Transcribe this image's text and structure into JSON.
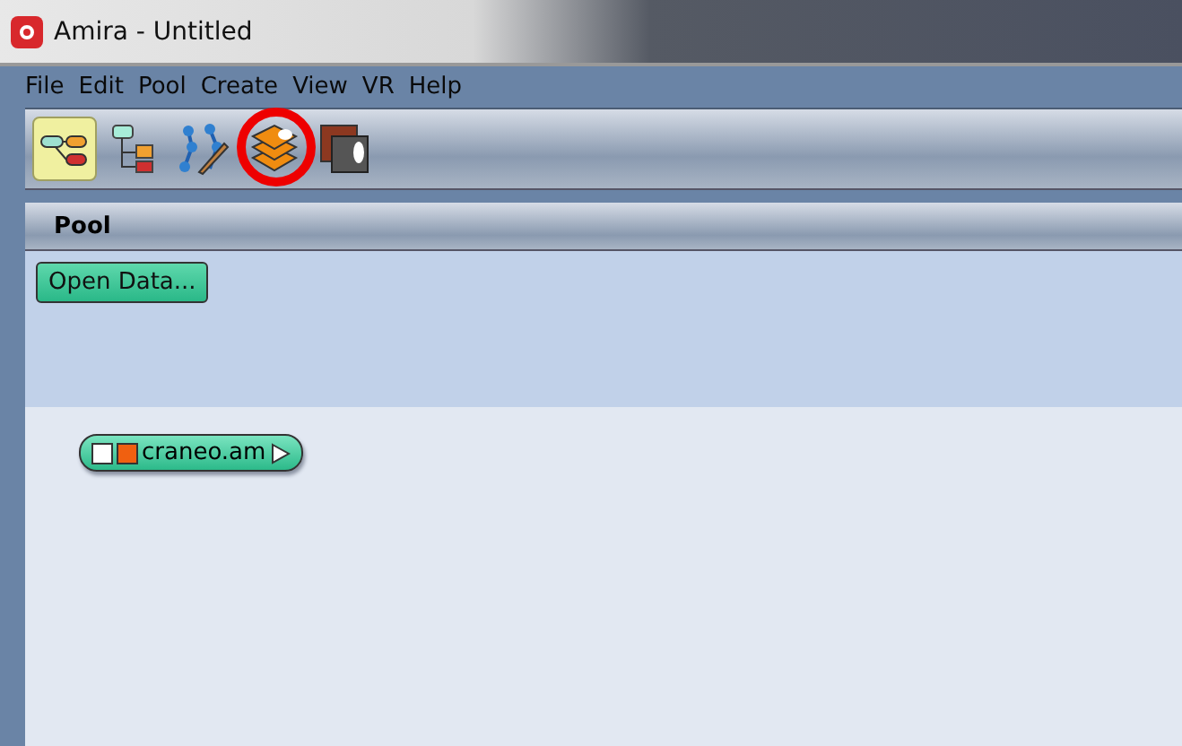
{
  "window": {
    "title": "Amira - Untitled"
  },
  "menu": [
    "File",
    "Edit",
    "Pool",
    "Create",
    "View",
    "VR",
    "Help"
  ],
  "toolbar": [
    {
      "kind": "pool",
      "selected": true
    },
    {
      "kind": "tree",
      "selected": false
    },
    {
      "kind": "network",
      "selected": false
    },
    {
      "kind": "layers",
      "selected": false,
      "highlighted": true
    },
    {
      "kind": "viewer",
      "selected": false
    }
  ],
  "pool": {
    "title": "Pool",
    "button": "Open Data...",
    "objects": [
      {
        "name": "craneo.am"
      }
    ]
  }
}
